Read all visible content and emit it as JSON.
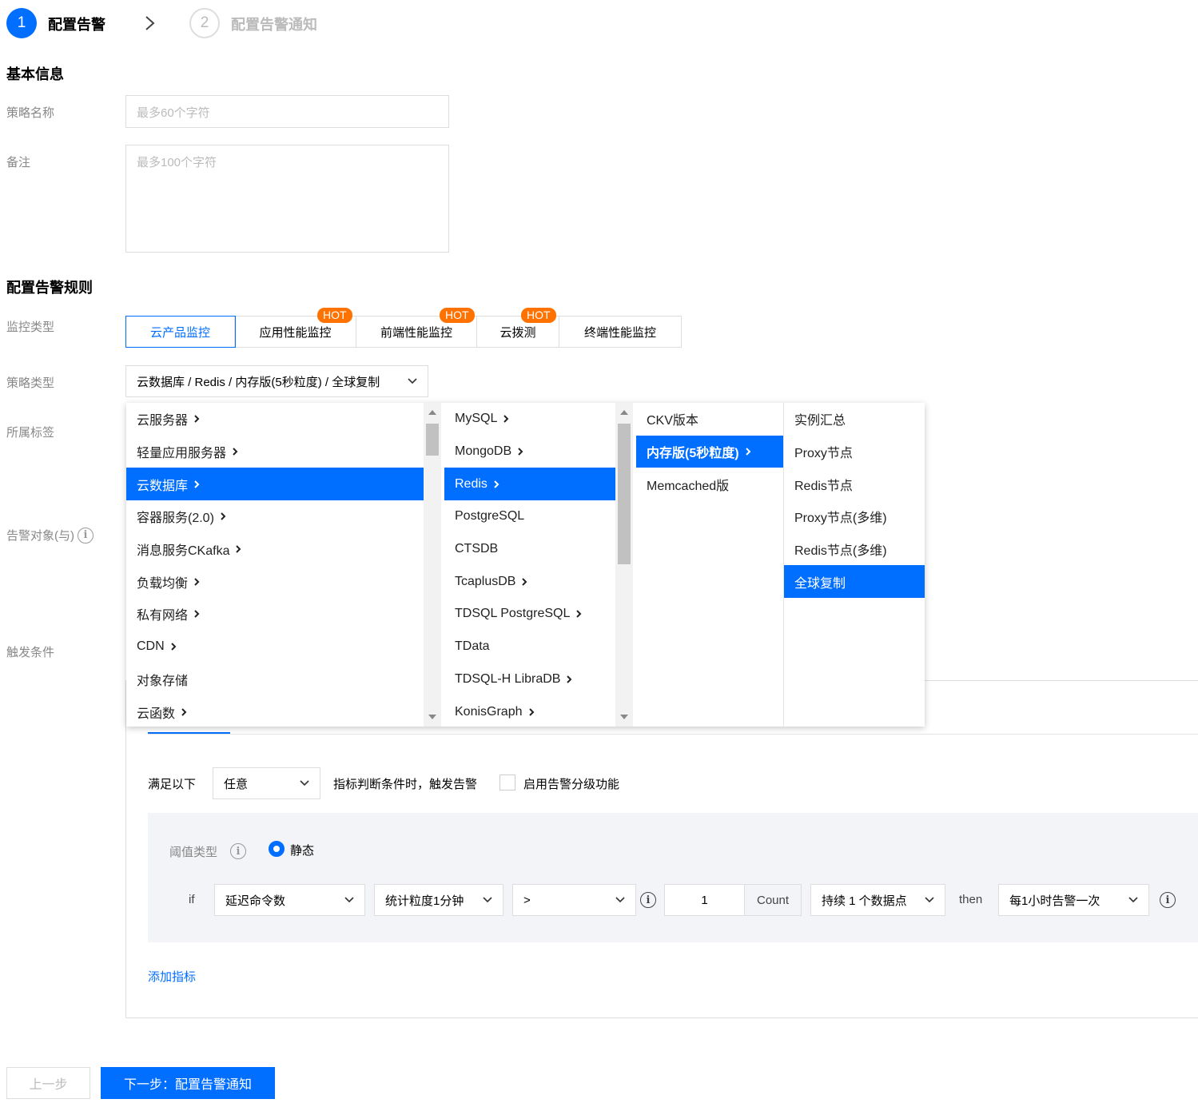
{
  "steps": {
    "step1_num": "1",
    "step1_label": "配置告警",
    "step2_num": "2",
    "step2_label": "配置告警通知"
  },
  "basic_info": {
    "title": "基本信息",
    "name_label": "策略名称",
    "name_placeholder": "最多60个字符",
    "remark_label": "备注",
    "remark_placeholder": "最多100个字符"
  },
  "rules": {
    "title": "配置告警规则",
    "monitor_type_label": "监控类型",
    "policy_type_label": "策略类型",
    "tag_label": "所属标签",
    "target_label": "告警对象(与)",
    "trigger_label": "触发条件"
  },
  "monitor_tabs": [
    {
      "label": "云产品监控",
      "hot": "",
      "active": true
    },
    {
      "label": "应用性能监控",
      "hot": "HOT",
      "active": false
    },
    {
      "label": "前端性能监控",
      "hot": "HOT",
      "active": false
    },
    {
      "label": "云拨测",
      "hot": "HOT",
      "active": false
    },
    {
      "label": "终端性能监控",
      "hot": "",
      "active": false
    }
  ],
  "policy_select": {
    "value": "云数据库 / Redis / 内存版(5秒粒度) / 全球复制"
  },
  "cascader": {
    "col1": [
      {
        "label": "云服务器",
        "arrow": true
      },
      {
        "label": "轻量应用服务器",
        "arrow": true
      },
      {
        "label": "云数据库",
        "arrow": true,
        "selected": true
      },
      {
        "label": "容器服务(2.0)",
        "arrow": true
      },
      {
        "label": "消息服务CKafka",
        "arrow": true
      },
      {
        "label": "负载均衡",
        "arrow": true
      },
      {
        "label": "私有网络",
        "arrow": true
      },
      {
        "label": "CDN",
        "arrow": true
      },
      {
        "label": "对象存储",
        "arrow": false
      },
      {
        "label": "云函数",
        "arrow": true
      }
    ],
    "col2": [
      {
        "label": "MySQL",
        "arrow": true
      },
      {
        "label": "MongoDB",
        "arrow": true
      },
      {
        "label": "Redis",
        "arrow": true,
        "selected": true
      },
      {
        "label": "PostgreSQL",
        "arrow": false
      },
      {
        "label": "CTSDB",
        "arrow": false
      },
      {
        "label": "TcaplusDB",
        "arrow": true
      },
      {
        "label": "TDSQL PostgreSQL",
        "arrow": true
      },
      {
        "label": "TData",
        "arrow": false
      },
      {
        "label": "TDSQL-H LibraDB",
        "arrow": true
      },
      {
        "label": "KonisGraph",
        "arrow": true
      }
    ],
    "col3": [
      {
        "label": "CKV版本",
        "arrow": false
      },
      {
        "label": "内存版(5秒粒度)",
        "arrow": true,
        "selected": true
      },
      {
        "label": "Memcached版",
        "arrow": false
      }
    ],
    "col4": [
      {
        "label": "实例汇总",
        "arrow": false
      },
      {
        "label": "Proxy节点",
        "arrow": false
      },
      {
        "label": "Redis节点",
        "arrow": false
      },
      {
        "label": "Proxy节点(多维)",
        "arrow": false
      },
      {
        "label": "Redis节点(多维)",
        "arrow": false
      },
      {
        "label": "全球复制",
        "arrow": false,
        "selected": true
      }
    ]
  },
  "trigger": {
    "satisfy_label": "满足以下",
    "satisfy_select": "任意",
    "satisfy_suffix": "指标判断条件时，触发告警",
    "grading_label": "启用告警分级功能",
    "threshold_label": "阈值类型",
    "threshold_value": "静态",
    "if_label": "if",
    "metric": "延迟命令数",
    "granularity": "统计粒度1分钟",
    "operator": ">",
    "threshold_input": "1",
    "unit": "Count",
    "duration": "持续 1 个数据点",
    "then_label": "then",
    "frequency": "每1小时告警一次",
    "add_metric": "添加指标"
  },
  "footer": {
    "prev": "上一步",
    "next": "下一步：配置告警通知"
  },
  "colors": {
    "primary": "#006eff",
    "hot": "#ff7200"
  }
}
